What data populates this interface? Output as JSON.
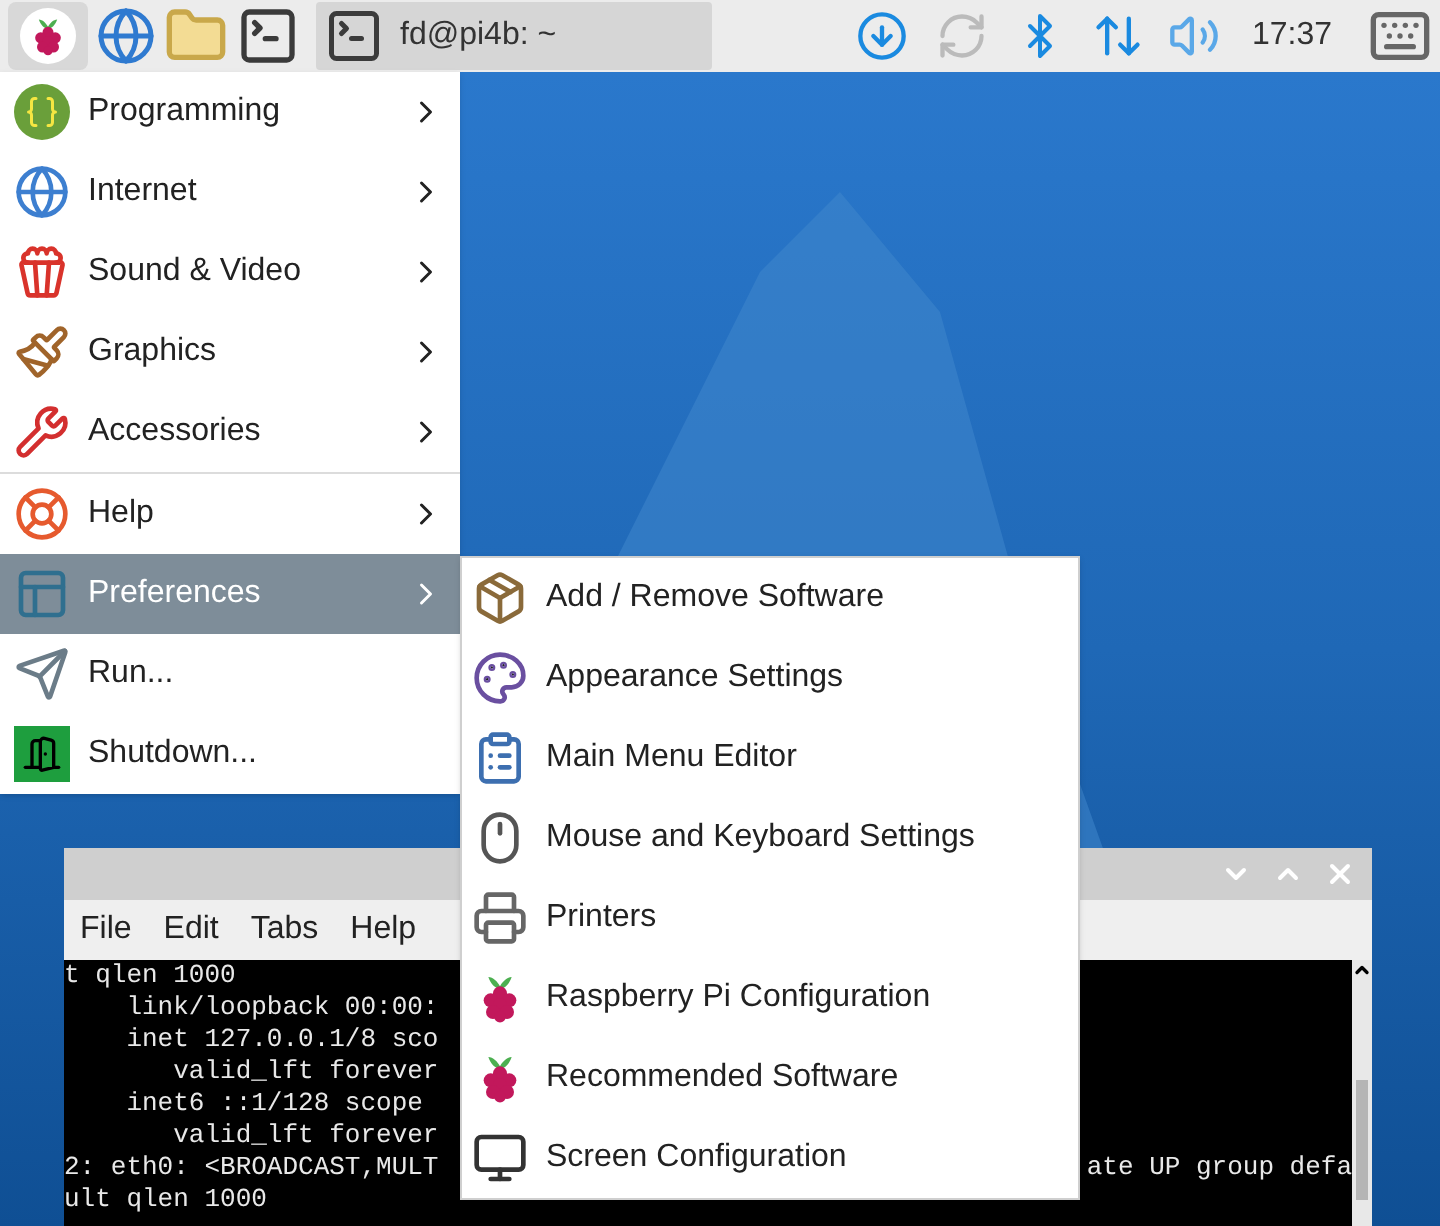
{
  "panel": {
    "taskbar": [
      {
        "label": "fd@pi4b: ~",
        "selected": true
      }
    ],
    "clock": "17:37"
  },
  "menu": {
    "groups": [
      [
        {
          "label": "Programming",
          "kind": "submenu",
          "selected": false
        },
        {
          "label": "Internet",
          "kind": "submenu",
          "selected": false
        },
        {
          "label": "Sound & Video",
          "kind": "submenu",
          "selected": false
        },
        {
          "label": "Graphics",
          "kind": "submenu",
          "selected": false
        },
        {
          "label": "Accessories",
          "kind": "submenu",
          "selected": false
        }
      ],
      [
        {
          "label": "Help",
          "kind": "submenu",
          "selected": false
        },
        {
          "label": "Preferences",
          "kind": "submenu",
          "selected": true
        },
        {
          "label": "Run...",
          "kind": "action",
          "selected": false
        },
        {
          "label": "Shutdown...",
          "kind": "action",
          "selected": false
        }
      ]
    ]
  },
  "submenu": {
    "items": [
      {
        "label": "Add / Remove Software"
      },
      {
        "label": "Appearance Settings"
      },
      {
        "label": "Main Menu Editor"
      },
      {
        "label": "Mouse and Keyboard Settings"
      },
      {
        "label": "Printers"
      },
      {
        "label": "Raspberry Pi Configuration"
      },
      {
        "label": "Recommended Software"
      },
      {
        "label": "Screen Configuration"
      }
    ]
  },
  "terminal": {
    "menu": [
      "File",
      "Edit",
      "Tabs",
      "Help"
    ],
    "lines": [
      {
        "left": "t qlen 1000"
      },
      {
        "left": "    link/loopback 00:00:"
      },
      {
        "left": "    inet 127.0.0.1/8 sco"
      },
      {
        "left": "       valid_lft forever"
      },
      {
        "left": "    inet6 ::1/128 scope"
      },
      {
        "left": "       valid_lft forever"
      },
      {
        "left": "2: eth0: <BROADCAST,MULT",
        "right": "ate UP group defa"
      },
      {
        "left": "ult qlen 1000"
      }
    ]
  }
}
